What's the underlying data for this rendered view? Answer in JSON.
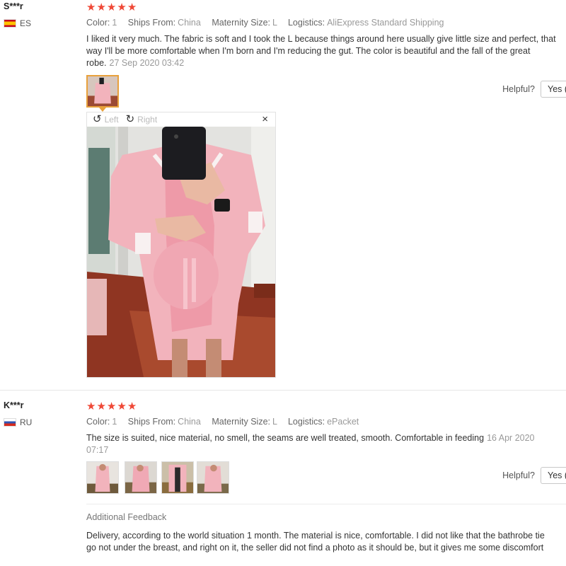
{
  "reviews": [
    {
      "user": "S***r",
      "country": "ES",
      "stars": 5,
      "color_label": "Color:",
      "color_value": "1",
      "ships_label": "Ships From:",
      "ships_value": "China",
      "size_label": "Maternity Size:",
      "size_value": "L",
      "logistics_label": "Logistics:",
      "logistics_value": "AliExpress Standard Shipping",
      "text": "I liked it very much. The fabric is soft and I took the L because things around here usually give little size and perfect, that way I'll be more comfortable when I'm born and I'm reducing the gut. The color is beautiful and the fall of the great robe.",
      "date": "27 Sep 2020 03:42",
      "helpful_label": "Helpful?",
      "yes_label": "Yes (",
      "viewer": {
        "left_label": "Left",
        "right_label": "Right",
        "close": "×"
      },
      "thumb_count": 1
    },
    {
      "user": "K***r",
      "country": "RU",
      "stars": 5,
      "color_label": "Color:",
      "color_value": "1",
      "ships_label": "Ships From:",
      "ships_value": "China",
      "size_label": "Maternity Size:",
      "size_value": "L",
      "logistics_label": "Logistics:",
      "logistics_value": "ePacket",
      "text": "The size is suited, nice material, no smell, the seams are well treated, smooth. Comfortable in feeding",
      "date": "16 Apr 2020 07:17",
      "helpful_label": "Helpful?",
      "yes_label": "Yes (",
      "thumb_count": 4,
      "additional_title": "Additional Feedback",
      "additional_text": "Delivery, according to the world situation 1 month. The material is nice, comfortable. I did not like that the bathrobe tie go not under the breast, and right on it, the seller did not find a photo as it should be, but it gives me some discomfort"
    }
  ],
  "icons": {
    "star": "★",
    "rotate_left": "rotate-left-icon",
    "rotate_right": "rotate-right-icon",
    "close": "close-icon"
  },
  "colors": {
    "star": "#ef4836",
    "thumb_selected": "#e8a13c",
    "robe": "#f2b3bc"
  }
}
